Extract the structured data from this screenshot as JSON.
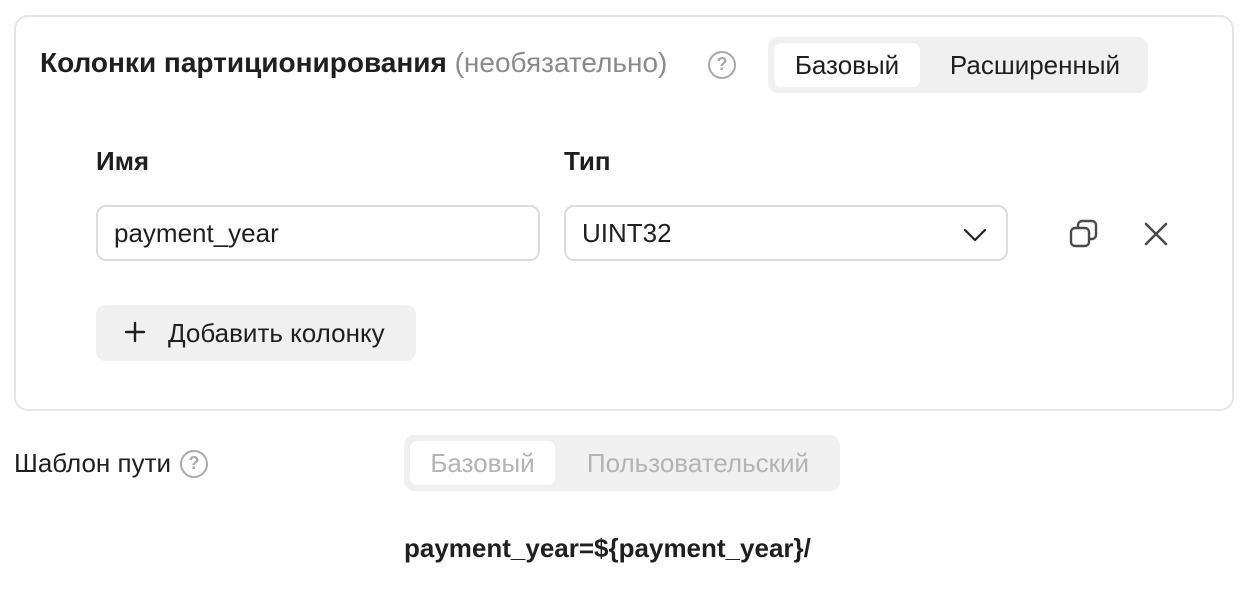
{
  "partition": {
    "title": "Колонки партиционирования",
    "optional": "(необязательно)",
    "help_glyph": "?",
    "mode_tabs": [
      {
        "label": "Базовый",
        "active": true
      },
      {
        "label": "Расширенный",
        "active": false
      }
    ],
    "columns": {
      "name_header": "Имя",
      "type_header": "Тип",
      "rows": [
        {
          "name": "payment_year",
          "type": "UINT32"
        }
      ]
    },
    "add_column_label": "Добавить колонку"
  },
  "path_template": {
    "label": "Шаблон пути",
    "help_glyph": "?",
    "mode_tabs": [
      {
        "label": "Базовый",
        "active": true,
        "disabled": true
      },
      {
        "label": "Пользовательский",
        "active": false,
        "disabled": true
      }
    ],
    "preview": "payment_year=${payment_year}/"
  },
  "icons": {
    "help": "question-circle-icon",
    "dropdown": "chevron-down-icon",
    "copy": "copy-icon",
    "remove": "close-icon",
    "add": "plus-icon"
  },
  "colors": {
    "border": "#e5e5e5",
    "field_border": "#dcdcdc",
    "segment_bg": "#f0f0f0",
    "muted_text": "#8a8a8a",
    "disabled_text": "#b3b3b3",
    "text": "#1f1f1f"
  }
}
